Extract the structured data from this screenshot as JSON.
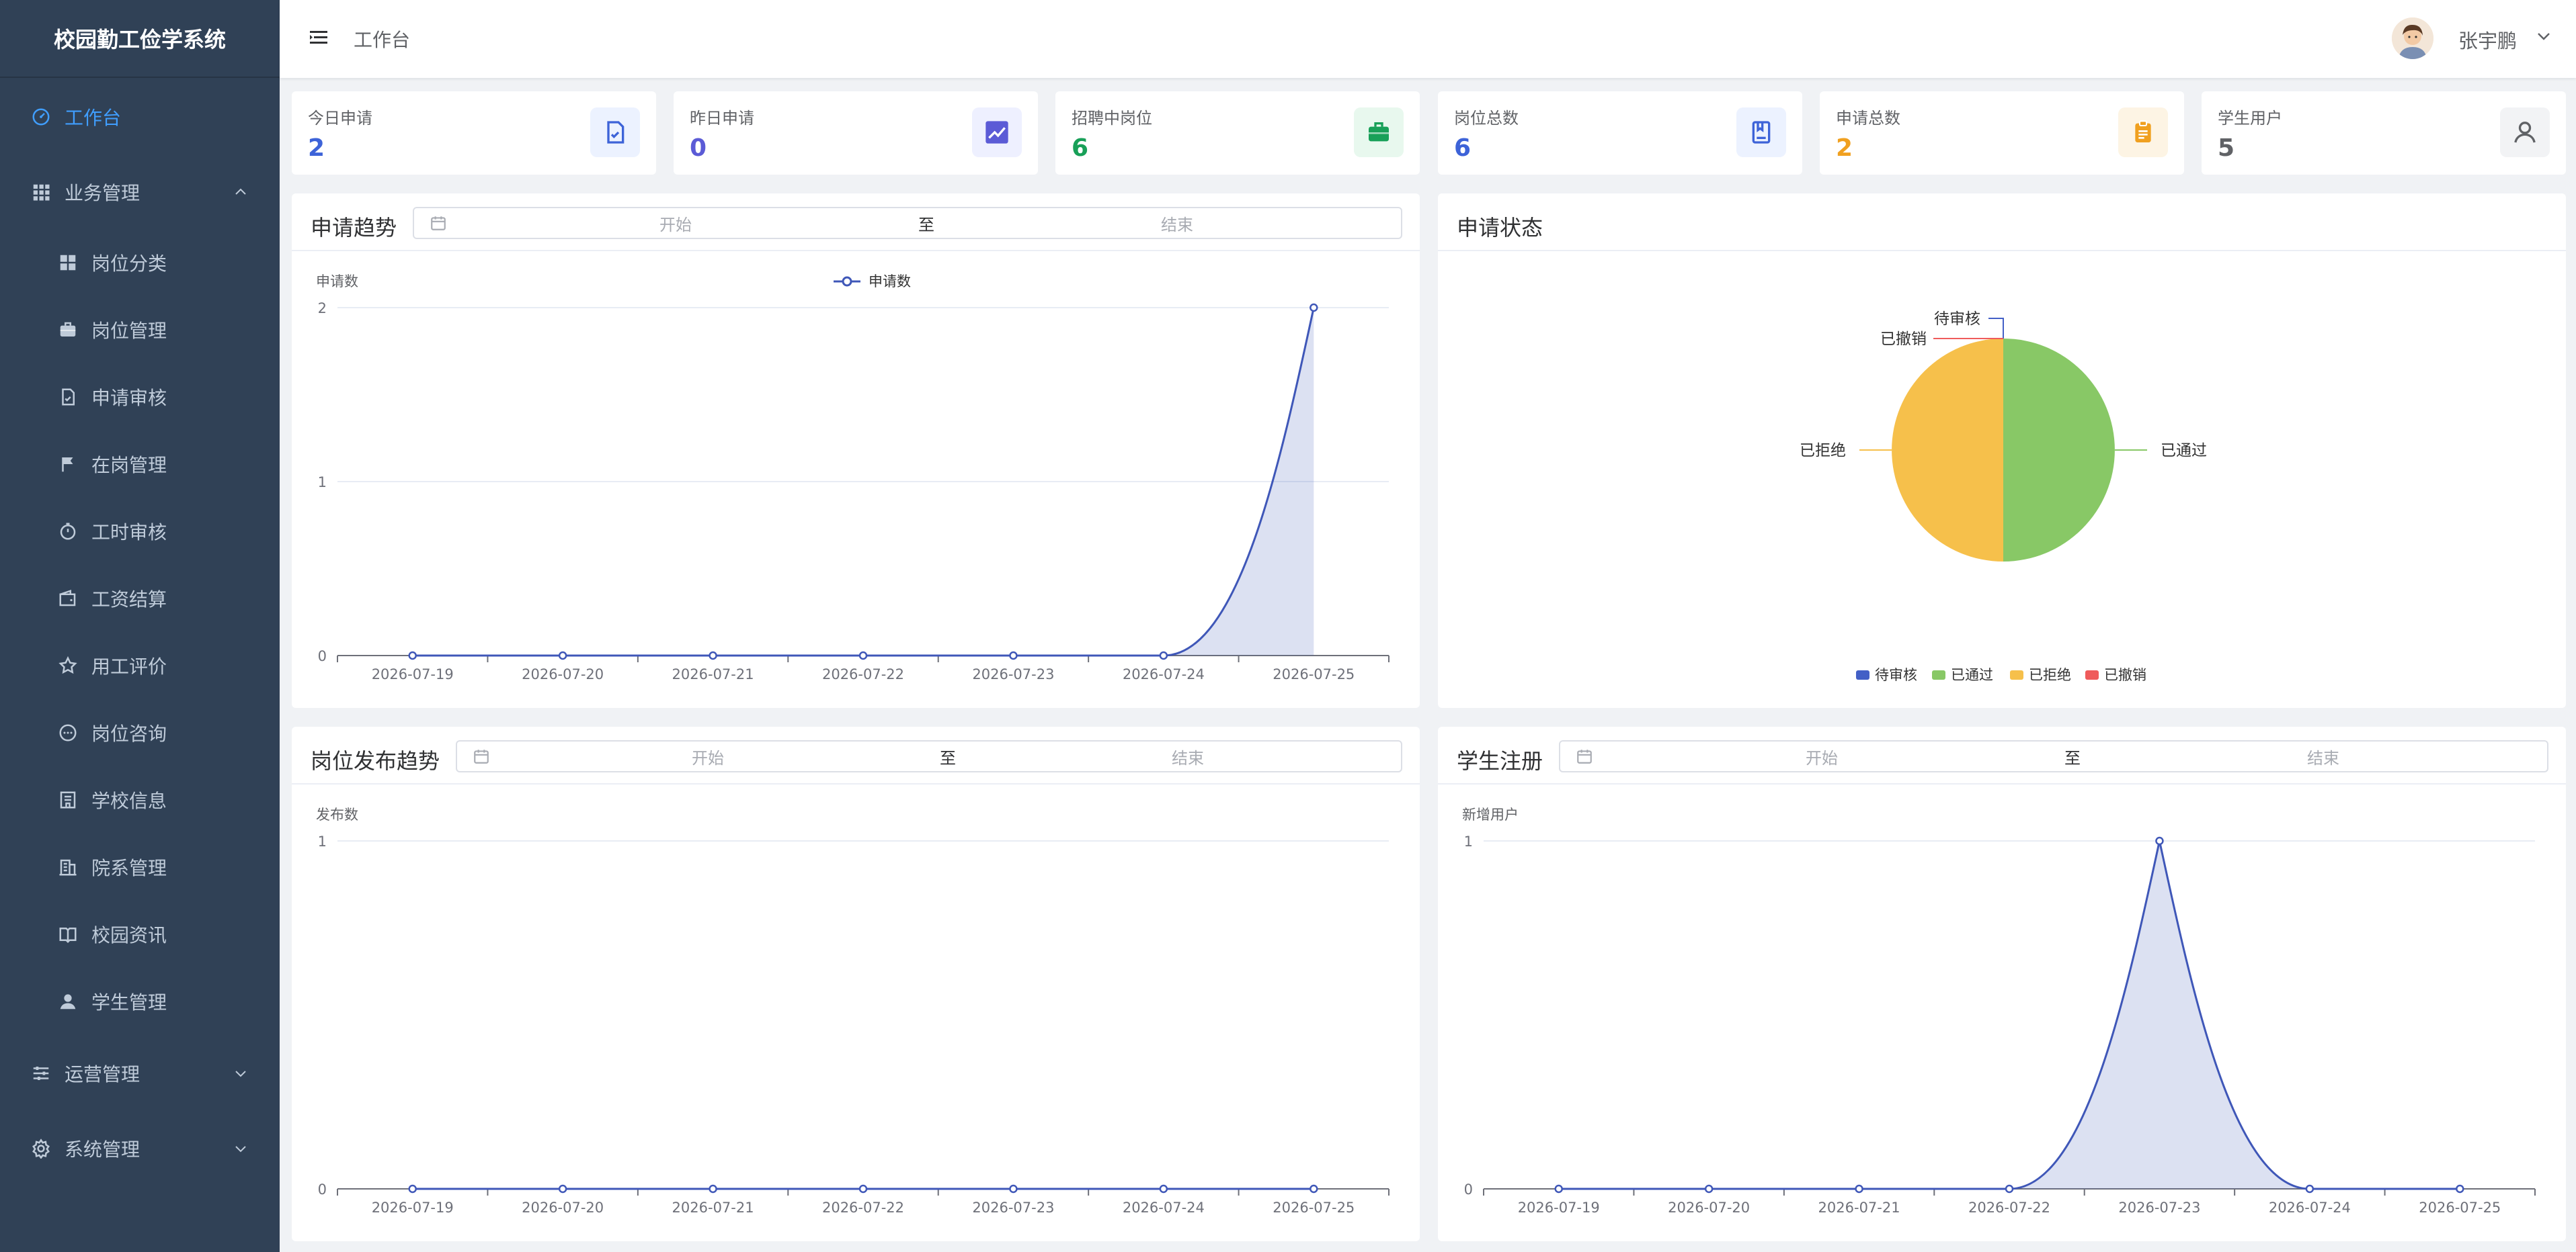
{
  "app": {
    "title": "校园勤工俭学系统"
  },
  "sidebar": {
    "items": [
      {
        "label": "工作台",
        "icon": "dashboard-icon",
        "level": 1,
        "active": true
      },
      {
        "label": "业务管理",
        "icon": "grid-icon",
        "level": 1,
        "expanded": true
      },
      {
        "label": "岗位分类",
        "icon": "category-icon",
        "level": 2
      },
      {
        "label": "岗位管理",
        "icon": "briefcase-icon",
        "level": 2
      },
      {
        "label": "申请审核",
        "icon": "document-check-icon",
        "level": 2
      },
      {
        "label": "在岗管理",
        "icon": "flag-icon",
        "level": 2
      },
      {
        "label": "工时审核",
        "icon": "stopwatch-icon",
        "level": 2
      },
      {
        "label": "工资结算",
        "icon": "wallet-icon",
        "level": 2
      },
      {
        "label": "用工评价",
        "icon": "star-icon",
        "level": 2
      },
      {
        "label": "岗位咨询",
        "icon": "chat-icon",
        "level": 2
      },
      {
        "label": "学校信息",
        "icon": "school-icon",
        "level": 2
      },
      {
        "label": "院系管理",
        "icon": "office-building-icon",
        "level": 2
      },
      {
        "label": "校园资讯",
        "icon": "reading-icon",
        "level": 2
      },
      {
        "label": "学生管理",
        "icon": "user-icon",
        "level": 2
      },
      {
        "label": "运营管理",
        "icon": "sliders-icon",
        "level": 1,
        "expanded": false
      },
      {
        "label": "系统管理",
        "icon": "gear-icon",
        "level": 1,
        "expanded": false
      }
    ]
  },
  "header": {
    "breadcrumb": "工作台",
    "user_name": "张宇鹏"
  },
  "stats": [
    {
      "label": "今日申请",
      "value": "2",
      "color": "#3d63d8",
      "bg": "#ecf2ff",
      "icon": "document-check-icon"
    },
    {
      "label": "昨日申请",
      "value": "0",
      "color": "#5b5bd6",
      "bg": "#eef0ff",
      "icon": "trend-chart-icon"
    },
    {
      "label": "招聘中岗位",
      "value": "6",
      "color": "#18a058",
      "bg": "#e8f8ee",
      "icon": "briefcase-icon"
    },
    {
      "label": "岗位总数",
      "value": "6",
      "color": "#3d63d8",
      "bg": "#ecf2ff",
      "icon": "notebook-icon"
    },
    {
      "label": "申请总数",
      "value": "2",
      "color": "#f0a020",
      "bg": "#fdf4e4",
      "icon": "clipboard-icon"
    },
    {
      "label": "学生用户",
      "value": "5",
      "color": "#606266",
      "bg": "#f2f3f5",
      "icon": "user-icon"
    }
  ],
  "date_range": {
    "start_placeholder": "开始",
    "separator": "至",
    "end_placeholder": "结束"
  },
  "panels": {
    "apply_trend": {
      "title": "申请趋势"
    },
    "apply_status": {
      "title": "申请状态"
    },
    "post_trend": {
      "title": "岗位发布趋势"
    },
    "student_reg": {
      "title": "学生注册"
    }
  },
  "chart_data": [
    {
      "type": "area",
      "ylabel": "申请数",
      "legend": [
        "申请数"
      ],
      "legend_position": "top-center",
      "x": [
        "2026-07-19",
        "2026-07-20",
        "2026-07-21",
        "2026-07-22",
        "2026-07-23",
        "2026-07-24",
        "2026-07-25"
      ],
      "series": [
        {
          "name": "申请数",
          "values": [
            0,
            0,
            0,
            0,
            0,
            0,
            2
          ]
        }
      ],
      "ylim": [
        0,
        2
      ],
      "yticks": [
        "0",
        "1",
        "2"
      ],
      "color": "#3f57b8"
    },
    {
      "type": "pie",
      "legend_position": "bottom",
      "slices": [
        {
          "name": "待审核",
          "value": 0,
          "color": "#4360c6"
        },
        {
          "name": "已通过",
          "value": 1,
          "color": "#88c866"
        },
        {
          "name": "已拒绝",
          "value": 1,
          "color": "#f6c04b"
        },
        {
          "name": "已撤销",
          "value": 0,
          "color": "#ef5b5b"
        }
      ]
    },
    {
      "type": "area",
      "ylabel": "发布数",
      "x": [
        "2026-07-19",
        "2026-07-20",
        "2026-07-21",
        "2026-07-22",
        "2026-07-23",
        "2026-07-24",
        "2026-07-25"
      ],
      "series": [
        {
          "values": [
            0,
            0,
            0,
            0,
            0,
            0,
            0
          ]
        }
      ],
      "ylim": [
        0,
        1
      ],
      "yticks": [
        "0",
        "1"
      ],
      "color": "#3f57b8"
    },
    {
      "type": "area",
      "ylabel": "新增用户",
      "x": [
        "2026-07-19",
        "2026-07-20",
        "2026-07-21",
        "2026-07-22",
        "2026-07-23",
        "2026-07-24",
        "2026-07-25"
      ],
      "series": [
        {
          "values": [
            0,
            0,
            0,
            0,
            1,
            0,
            0
          ]
        }
      ],
      "ylim": [
        0,
        1
      ],
      "yticks": [
        "0",
        "1"
      ],
      "color": "#3f57b8"
    }
  ]
}
